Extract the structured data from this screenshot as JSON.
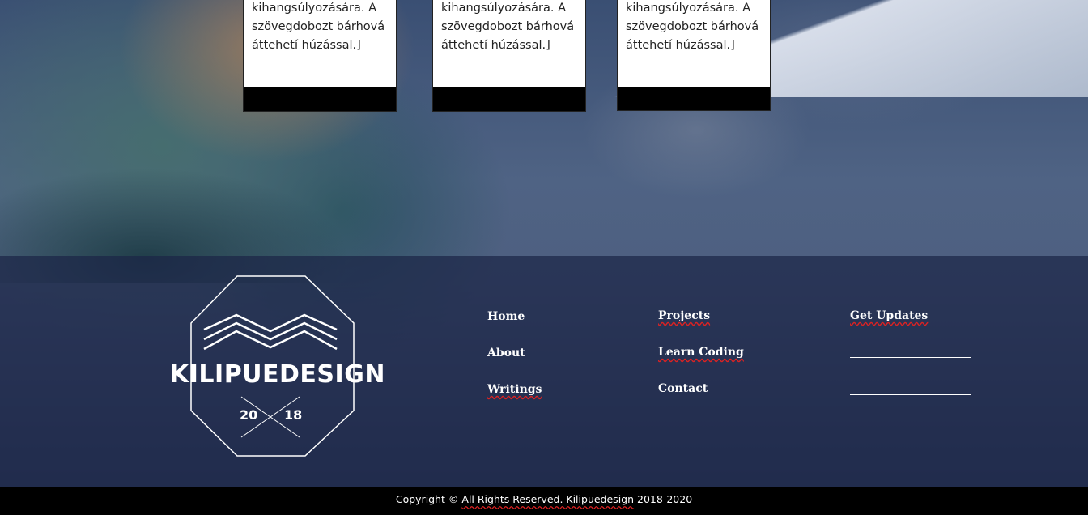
{
  "cards": [
    {
      "text": "kihangsúlyozására. A szövegdobozt bárhová áttehetí húzással.]"
    },
    {
      "text": "kihangsúlyozására. A szövegdobozt bárhová áttehetí húzással.]"
    },
    {
      "text": "kihangsúlyozására. A szövegdobozt bárhová áttehetí húzással.]"
    }
  ],
  "logo": {
    "name": "KILIPUEDESIGN",
    "year_left": "20",
    "year_right": "18"
  },
  "nav": {
    "col1": [
      "Home",
      "About",
      "Writings"
    ],
    "col2": [
      "Projects",
      "Learn Coding",
      "Contact"
    ],
    "col3_title": "Get Updates",
    "col3_lines": [
      "____________________",
      "____________________"
    ]
  },
  "footer": {
    "copyright_prefix": "Copyright ©",
    "copyright_underlined": "All Rights Reserved. Kilipuedesign",
    "copyright_suffix": "2018-2020"
  }
}
